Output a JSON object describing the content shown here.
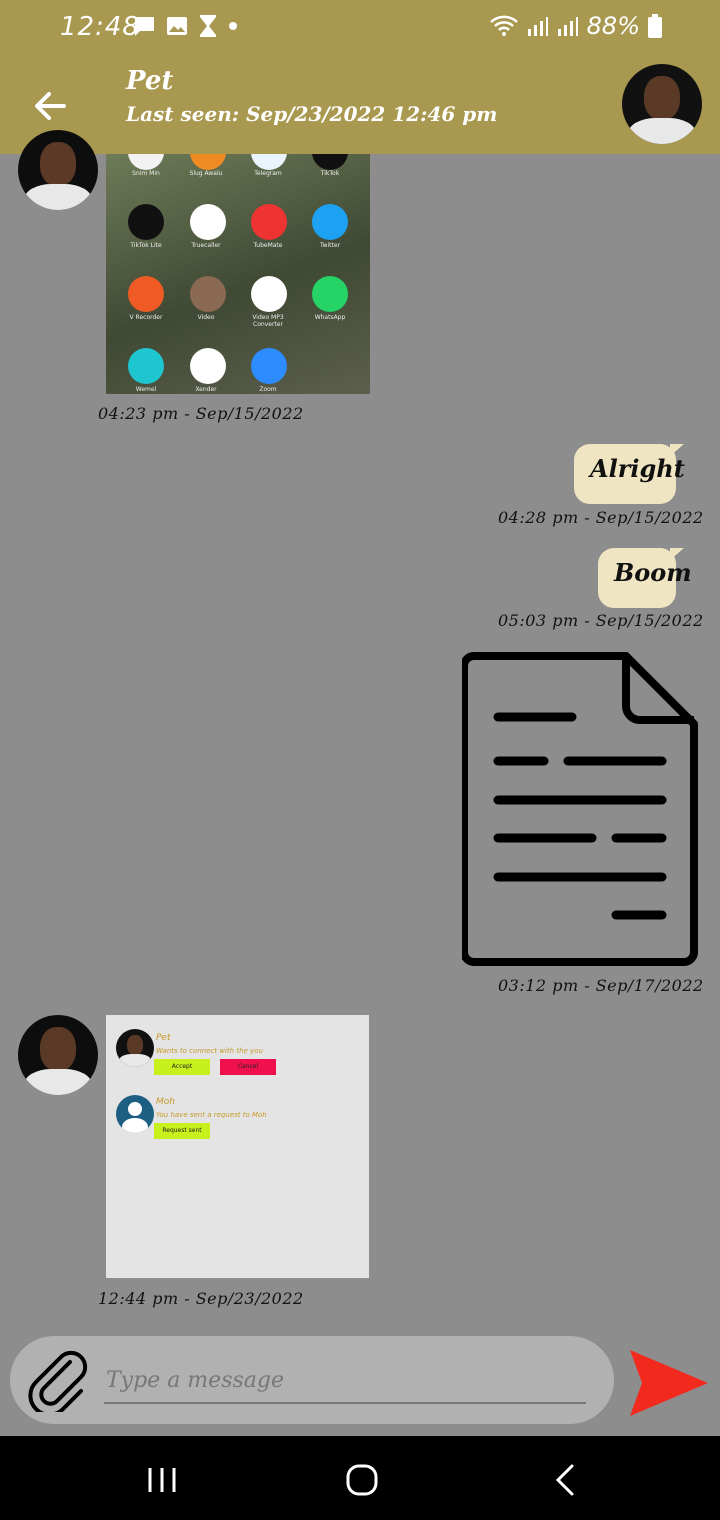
{
  "status_bar": {
    "time": "12:48",
    "battery": "88%"
  },
  "header": {
    "name": "Pet",
    "last_seen": "Last seen: Sep/23/2022 12:46 pm"
  },
  "messages": {
    "m1": {
      "time": "04:23 pm - Sep/15/2022"
    },
    "m2": {
      "text": "Alright",
      "time": "04:28 pm - Sep/15/2022"
    },
    "m3": {
      "text": "Boom",
      "time": "05:03 pm - Sep/15/2022"
    },
    "m4": {
      "time": "03:12 pm - Sep/17/2022"
    },
    "m5": {
      "time": "12:44 pm - Sep/23/2022"
    }
  },
  "phone_apps": {
    "row0": [
      "Snim Min",
      "Slug Awalu",
      "Telegram",
      "TikTok"
    ],
    "row1": [
      "TikTok Lite",
      "Truecaller",
      "TubeMate",
      "Twitter"
    ],
    "row2": [
      "V Recorder",
      "Video",
      "Video MP3 Converter",
      "WhatsApp"
    ],
    "row3": [
      "Wemel",
      "Xender",
      "Zoom"
    ]
  },
  "shot": {
    "r1_name": "Pet",
    "r1_text": "Wants to connect with the you",
    "accept": "Accept",
    "cancel": "Cancel",
    "r2_name": "Moh",
    "r2_text": "You have sent a request to Moh",
    "sent": "Request sent"
  },
  "composer": {
    "placeholder": "Type a message"
  },
  "colors": {
    "header": "#a9984f",
    "background": "#8e8d8d",
    "bubble": "#efe5c3",
    "send": "#f22a1e"
  }
}
